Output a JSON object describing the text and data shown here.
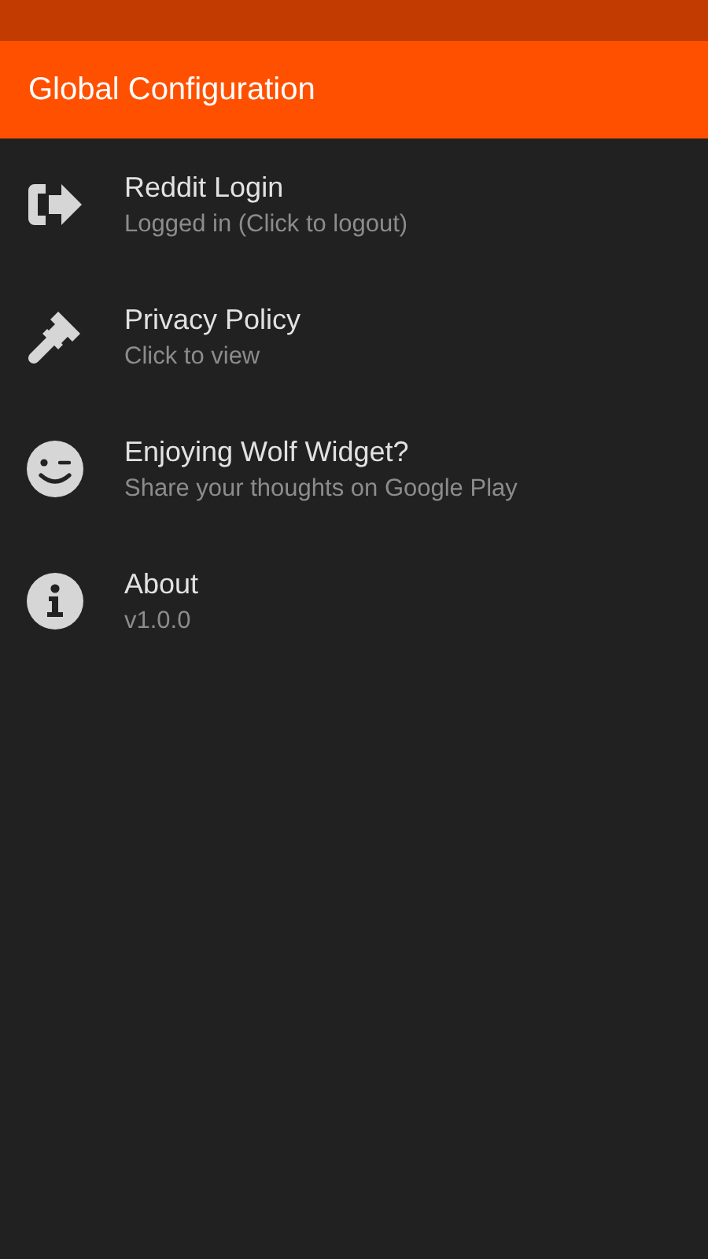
{
  "app_bar": {
    "title": "Global Configuration"
  },
  "items": [
    {
      "kind": "logout",
      "title": "Reddit Login",
      "subtitle": "Logged in (Click to logout)"
    },
    {
      "kind": "gavel",
      "title": "Privacy Policy",
      "subtitle": "Click to view"
    },
    {
      "kind": "smile",
      "title": "Enjoying Wolf Widget?",
      "subtitle": "Share your thoughts on Google Play"
    },
    {
      "kind": "info",
      "title": "About",
      "subtitle": "v1.0.0"
    }
  ]
}
